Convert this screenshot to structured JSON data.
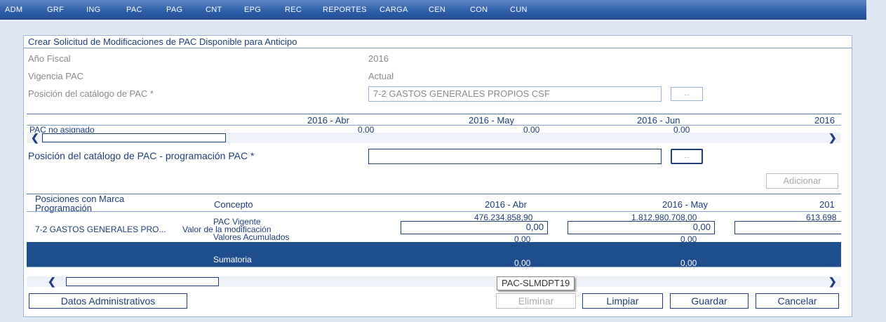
{
  "nav": [
    "ADM",
    "GRF",
    "ING",
    "PAC",
    "PAG",
    "CNT",
    "EPG",
    "REC",
    "REPORTES",
    "CARGA",
    "CEN",
    "CON",
    "CUN"
  ],
  "title": "Crear Solicitud de Modificaciones de PAC Disponible para Anticipo",
  "fields": {
    "anio_label": "Año Fiscal",
    "anio_value": "2016",
    "vigencia_label": "Vigencia PAC",
    "vigencia_value": "Actual",
    "posicion_label": "Posición del catálogo de PAC *",
    "posicion_value": "7-2 GASTOS GENERALES PROPIOS CSF",
    "browse": "...",
    "programacion_label": "Posición del catálogo de PAC - programación PAC *",
    "programacion_value": ""
  },
  "table1": {
    "headers": [
      "2016 - Abr",
      "2016 - May",
      "2016 - Jun",
      "2016"
    ],
    "row_label": "PAC no asignado",
    "values": [
      "0,00",
      "0,00",
      "0,00"
    ]
  },
  "adicionar": "Adicionar",
  "table2": {
    "col_posiciones": "Posiciones con Marca Programación",
    "col_concepto": "Concepto",
    "months": [
      "2016 - Abr",
      "2016 - May",
      "201"
    ],
    "row_name": "7-2 GASTOS GENERALES PRO...",
    "conceptos": [
      "PAC Vigente",
      "Valor de la modificación",
      "Valores Acumulados"
    ],
    "pac_vigente": [
      "476.234.858,90",
      "1.812.980.708,00",
      "613.698"
    ],
    "modificacion": [
      "0,00",
      "0,00",
      ""
    ],
    "acumulados": [
      "0,00",
      "0,00"
    ],
    "sumatoria_label": "Sumatoria",
    "sumatoria": [
      "0,00",
      "0,00"
    ]
  },
  "tooltip": "PAC-SLMDPT19",
  "buttons": {
    "datos": "Datos Administrativos",
    "eliminar": "Eliminar",
    "limpiar": "Limpiar",
    "guardar": "Guardar",
    "cancelar": "Cancelar"
  },
  "arrows": {
    "left": "❮",
    "right": "❯"
  }
}
